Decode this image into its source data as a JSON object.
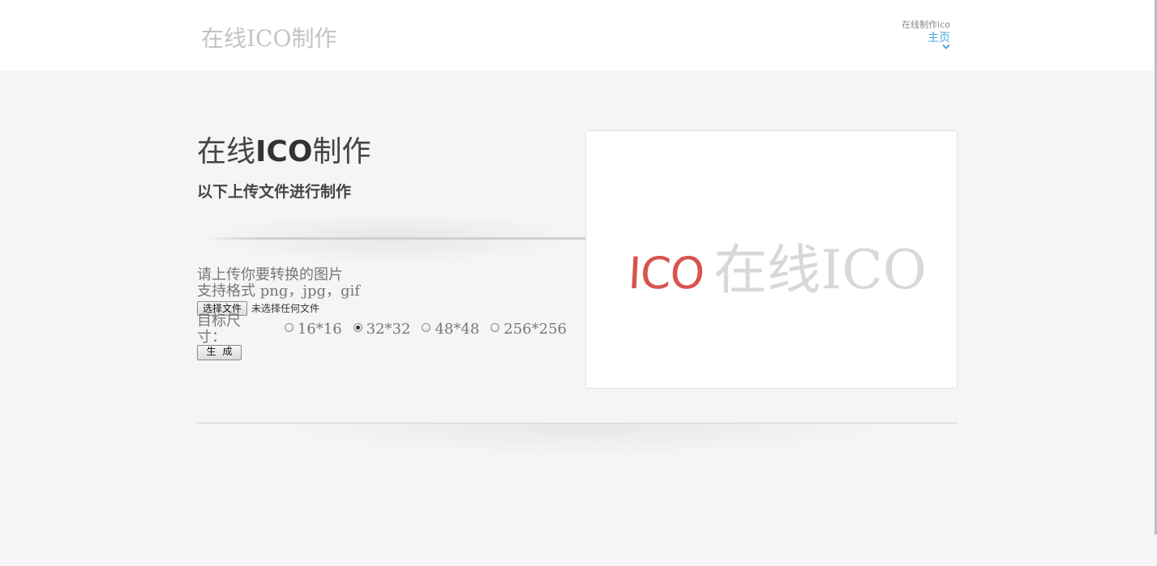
{
  "header": {
    "logo_text": "在线ICO制作",
    "nav_sub": "在线制作ico",
    "nav_main": "主页"
  },
  "main": {
    "title_prefix": "在线",
    "title_bold": "ICO",
    "title_suffix": "制作",
    "subtitle": "以下上传文件进行制作"
  },
  "form": {
    "instruction": "请上传你要转换的图片",
    "formats": "支持格式 png，jpg，gif",
    "file_button": "选择文件",
    "file_status": "未选择任何文件",
    "size_label": "目标尺寸：",
    "sizes": [
      {
        "label": "16*16",
        "checked": false
      },
      {
        "label": "32*32",
        "checked": true
      },
      {
        "label": "48*48",
        "checked": false
      },
      {
        "label": "256*256",
        "checked": false
      }
    ],
    "generate_button": "生成"
  },
  "preview": {
    "logo_red": "ICO",
    "logo_grey": "在线ICO"
  },
  "colors": {
    "accent_blue": "#4aa8dc",
    "logo_red": "#d9534f",
    "background": "#f5f5f5"
  }
}
